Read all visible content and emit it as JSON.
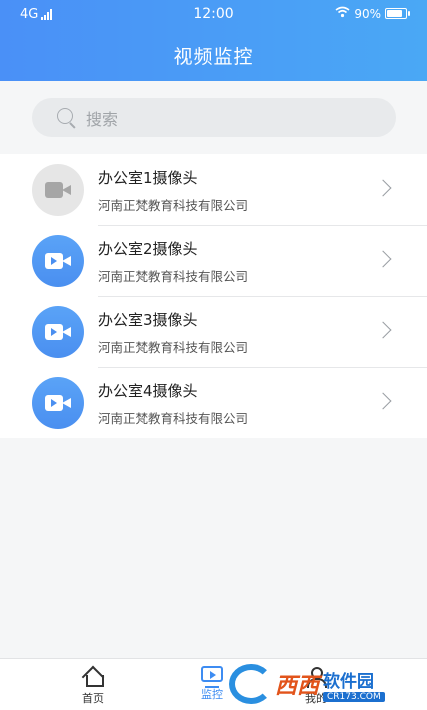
{
  "status_bar": {
    "network": "4G",
    "time": "12:00",
    "battery": "90%",
    "battery_level": 0.9
  },
  "header": {
    "title": "视频监控"
  },
  "search": {
    "placeholder": "搜索"
  },
  "cameras": [
    {
      "name": "办公室1摄像头",
      "company": "河南正梵教育科技有限公司",
      "status": "offline"
    },
    {
      "name": "办公室2摄像头",
      "company": "河南正梵教育科技有限公司",
      "status": "online"
    },
    {
      "name": "办公室3摄像头",
      "company": "河南正梵教育科技有限公司",
      "status": "online"
    },
    {
      "name": "办公室4摄像头",
      "company": "河南正梵教育科技有限公司",
      "status": "online"
    }
  ],
  "tabbar": {
    "tabs": [
      {
        "label": "首页",
        "icon": "home-icon"
      },
      {
        "label": "监控",
        "icon": "monitor-icon",
        "active": true
      },
      {
        "label": "我的",
        "icon": "user-icon"
      }
    ]
  },
  "watermark": {
    "brand": "西西",
    "name": "软件园",
    "url": "CR173.COM"
  },
  "colors": {
    "accent": "#3d8cf2",
    "header_start": "#4a90f7",
    "header_end": "#4aa8f5"
  }
}
